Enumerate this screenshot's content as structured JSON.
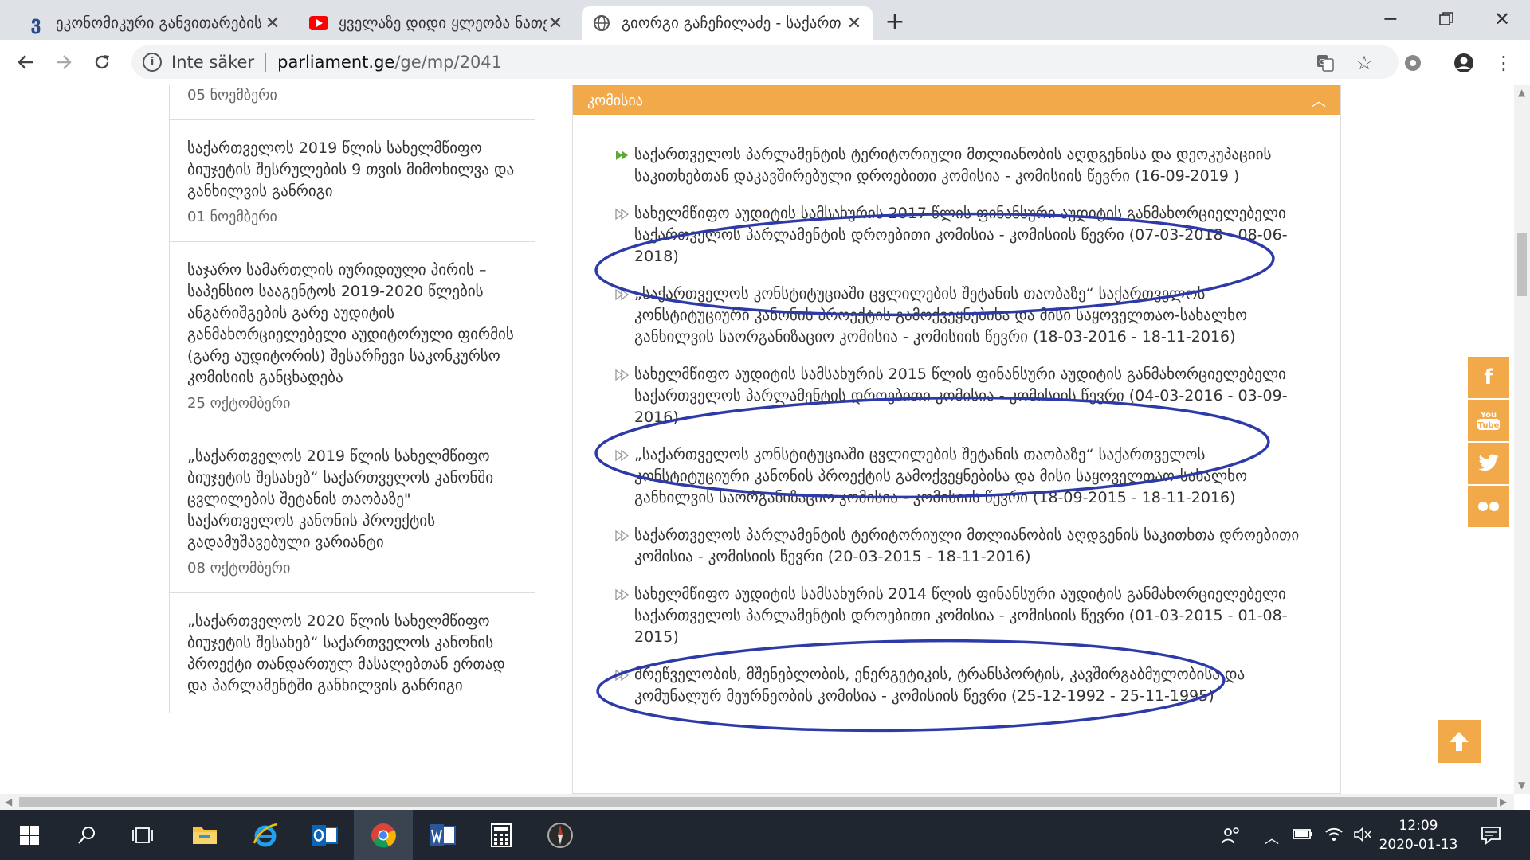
{
  "tabs": [
    {
      "title": "ეკონომიკური განვითარების",
      "active": false
    },
    {
      "title": "ყველაზე დიდი ყლეობა ნათე",
      "active": false
    },
    {
      "title": "გიორგი გაჩეჩილაძე - საქართ",
      "active": true
    }
  ],
  "address": {
    "security": "Inte säker",
    "host": "parliament.ge",
    "path": "/ge/mp/2041"
  },
  "news": [
    {
      "title": "",
      "date": "05 ნოემბერი"
    },
    {
      "title": "საქართველოს 2019 წლის სახელმწიფო ბიუჯეტის შესრულების 9 თვის მიმოხილვა და განხილვის განრიგი",
      "date": "01 ნოემბერი"
    },
    {
      "title": "საჯარო სამართლის იურიდიული პირის – საპენსიო სააგენტოს 2019-2020 წლების ანგარიშგების გარე აუდიტის განმახორციელებელი აუდიტორული ფირმის (გარე აუდიტორის) შესარჩევი საკონკურსო კომისიის განცხადება",
      "date": "25 ოქტომბერი"
    },
    {
      "title": "„საქართველოს 2019 წლის სახელმწიფო ბიუჯეტის შესახებ“ საქართველოს კანონში ცვლილების შეტანის თაობაზე\" საქართველოს კანონის პროექტის გადამუშავებული ვარიანტი",
      "date": "08 ოქტომბერი"
    },
    {
      "title": "„საქართველოს 2020 წლის სახელმწიფო ბიუჯეტის შესახებ“ საქართველოს კანონის პროექტი თანდართულ მასალებთან ერთად და პარლამენტში განხილვის განრიგი",
      "date": ""
    }
  ],
  "panel": {
    "header": "კომისია",
    "items": [
      {
        "text": "საქართველოს პარლამენტის ტერიტორიული მთლიანობის აღდგენისა და დეოკუპაციის საკითხებთან დაკავშირებული დროებითი კომისია - კომისიის წევრი (16-09-2019 )",
        "current": true
      },
      {
        "text": "სახელმწიფო აუდიტის სამსახურის 2017 წლის ფინანსური აუდიტის განმახორციელებელი საქართველოს პარლამენტის დროებითი კომისია - კომისიის წევრი (07-03-2018 - 08-06-2018)",
        "current": false
      },
      {
        "text": "„საქართველოს კონსტიტუციაში ცვლილების შეტანის თაობაზე“ საქართველოს კონსტიტუციური კანონის პროექტის გამოქვეყნებისა და მისი საყოველთაო-სახალხო განხილვის საორგანიზაციო კომისია - კომისიის წევრი (18-03-2016 - 18-11-2016)",
        "current": false
      },
      {
        "text": "სახელმწიფო აუდიტის სამსახურის 2015 წლის ფინანსური აუდიტის განმახორციელებელი საქართველოს პარლამენტის დროებითი კომისია - კომისიის წევრი (04-03-2016 - 03-09-2016)",
        "current": false
      },
      {
        "text": "„საქართველოს კონსტიტუციაში ცვლილების შეტანის თაობაზე“ საქართველოს კონსტიტუციური კანონის პროექტის გამოქვეყნებისა და მისი საყოველთაო-სახალხო განხილვის საორგანიზაციო კომისია - კომისიის წევრი (18-09-2015 - 18-11-2016)",
        "current": false
      },
      {
        "text": "საქართველოს პარლამენტის ტერიტორიული მთლიანობის აღდგენის საკითხთა დროებითი კომისია - კომისიის წევრი (20-03-2015 - 18-11-2016)",
        "current": false
      },
      {
        "text": "სახელმწიფო აუდიტის სამსახურის 2014 წლის ფინანსური აუდიტის განმახორციელებელი საქართველოს პარლამენტის დროებითი კომისია - კომისიის წევრი (01-03-2015 - 01-08-2015)",
        "current": false
      },
      {
        "text": "მრეწველობის, მშენებლობის, ენერგეტიკის, ტრანსპორტის, კავშირგაბმულობისა და კომუნალურ მეურნეობის კომისია - კომისიის წევრი (25-12-1992 - 25-11-1995)",
        "current": false
      }
    ]
  },
  "social": [
    {
      "name": "facebook-icon",
      "glyph": "f"
    },
    {
      "name": "youtube-icon",
      "glyph": ""
    },
    {
      "name": "twitter-icon",
      "glyph": ""
    },
    {
      "name": "flickr-icon",
      "glyph": ""
    }
  ],
  "youtube_badge": {
    "line1": "You",
    "line2": "Tube"
  },
  "colors": {
    "accent": "#f2a94a",
    "oval": "#2d3aa8"
  },
  "clock": {
    "time": "12:09",
    "date": "2020-01-13"
  }
}
